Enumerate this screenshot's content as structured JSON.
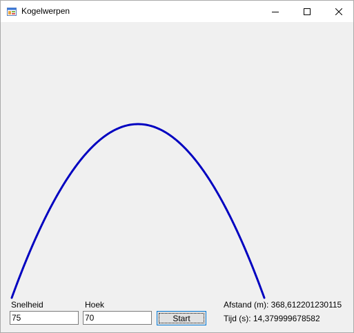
{
  "window": {
    "title": "Kogelwerpen",
    "app_icon": "winforms-app-icon",
    "controls": {
      "minimize_icon": "minimize-icon",
      "maximize_icon": "maximize-icon",
      "close_icon": "close-icon"
    }
  },
  "trajectory": {
    "color": "#0000c0",
    "description_icon": "trajectory-curve"
  },
  "inputs": {
    "speed_label": "Snelheid",
    "speed_value": "75",
    "angle_label": "Hoek",
    "angle_value": "70",
    "start_label": "Start"
  },
  "results": {
    "distance_label": "Afstand (m): 368,612201230115",
    "time_label": "Tijd (s): 14,379999678582"
  }
}
